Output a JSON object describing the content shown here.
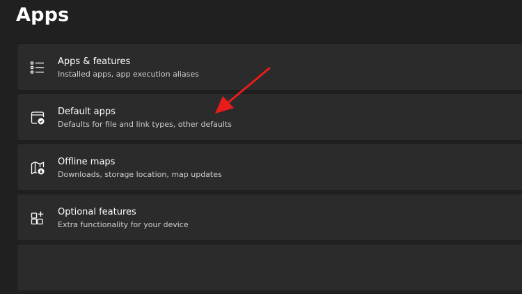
{
  "page": {
    "title": "Apps"
  },
  "items": [
    {
      "title": "Apps & features",
      "subtitle": "Installed apps, app execution aliases",
      "icon": "list-icon"
    },
    {
      "title": "Default apps",
      "subtitle": "Defaults for file and link types, other defaults",
      "icon": "default-apps-icon"
    },
    {
      "title": "Offline maps",
      "subtitle": "Downloads, storage location, map updates",
      "icon": "map-download-icon"
    },
    {
      "title": "Optional features",
      "subtitle": "Extra functionality for your device",
      "icon": "optional-features-icon"
    }
  ],
  "colors": {
    "background": "#202020",
    "card": "#2b2b2b",
    "annotation_arrow": "#e81c1c"
  }
}
